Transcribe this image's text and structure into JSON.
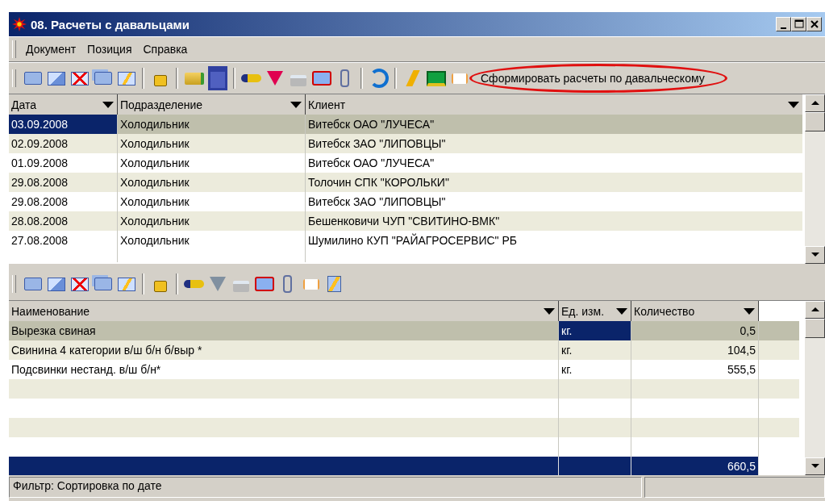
{
  "window": {
    "title": "08. Расчеты с давальцами"
  },
  "menu": [
    {
      "label": "Документ"
    },
    {
      "label": "Позиция"
    },
    {
      "label": "Справка"
    }
  ],
  "toolbar": {
    "action_button": "Сформировать расчеты по давальческому",
    "highlighted": true
  },
  "documents": {
    "columns": [
      "Дата",
      "Подразделение",
      "Клиент"
    ],
    "rows": [
      {
        "selected": true,
        "cells": [
          {
            "text": "03.09.2008",
            "focused": true
          },
          {
            "text": "Холодильник",
            "focused": false
          },
          {
            "text": "Витебск ОАО \"ЛУЧЕСА\"",
            "focused": false
          }
        ]
      },
      {
        "selected": false,
        "cells": [
          {
            "text": "02.09.2008",
            "focused": false
          },
          {
            "text": "Холодильник",
            "focused": false
          },
          {
            "text": "Витебск ЗАО \"ЛИПОВЦЫ\"",
            "focused": false
          }
        ]
      },
      {
        "selected": false,
        "cells": [
          {
            "text": "01.09.2008",
            "focused": false
          },
          {
            "text": "Холодильник",
            "focused": false
          },
          {
            "text": "Витебск ОАО \"ЛУЧЕСА\"",
            "focused": false
          }
        ]
      },
      {
        "selected": false,
        "cells": [
          {
            "text": "29.08.2008",
            "focused": false
          },
          {
            "text": "Холодильник",
            "focused": false
          },
          {
            "text": "Толочин СПК \"КОРОЛЬКИ\"",
            "focused": false
          }
        ]
      },
      {
        "selected": false,
        "cells": [
          {
            "text": "29.08.2008",
            "focused": false
          },
          {
            "text": "Холодильник",
            "focused": false
          },
          {
            "text": "Витебск ЗАО \"ЛИПОВЦЫ\"",
            "focused": false
          }
        ]
      },
      {
        "selected": false,
        "cells": [
          {
            "text": "28.08.2008",
            "focused": false
          },
          {
            "text": "Холодильник",
            "focused": false
          },
          {
            "text": "Бешенковичи ЧУП \"СВИТИНО-ВМК\"",
            "focused": false
          }
        ]
      },
      {
        "selected": false,
        "cells": [
          {
            "text": "27.08.2008",
            "focused": false
          },
          {
            "text": "Холодильник",
            "focused": false
          },
          {
            "text": "Шумилино КУП \"РАЙАГРОСЕРВИС\" РБ",
            "focused": false
          }
        ]
      }
    ]
  },
  "positions": {
    "columns": [
      "Наименование",
      "Ед. изм.",
      "Количество"
    ],
    "rows": [
      {
        "selected": true,
        "cells": [
          {
            "text": "Вырезка свиная",
            "focused": false
          },
          {
            "text": "кг.",
            "focused": true
          },
          {
            "text": "0,5",
            "focused": false
          }
        ]
      },
      {
        "selected": false,
        "cells": [
          {
            "text": "Свинина 4 категории в/ш б/н б/выр *",
            "focused": false
          },
          {
            "text": "кг.",
            "focused": false
          },
          {
            "text": "104,5",
            "focused": false
          }
        ]
      },
      {
        "selected": false,
        "cells": [
          {
            "text": "Подсвинки нестанд. в/ш б/н*",
            "focused": false
          },
          {
            "text": "кг.",
            "focused": false
          },
          {
            "text": "555,5",
            "focused": false
          }
        ]
      }
    ],
    "total": "660,5"
  },
  "status_bar": {
    "filter": "Фильтр: Сортировка по дате"
  }
}
